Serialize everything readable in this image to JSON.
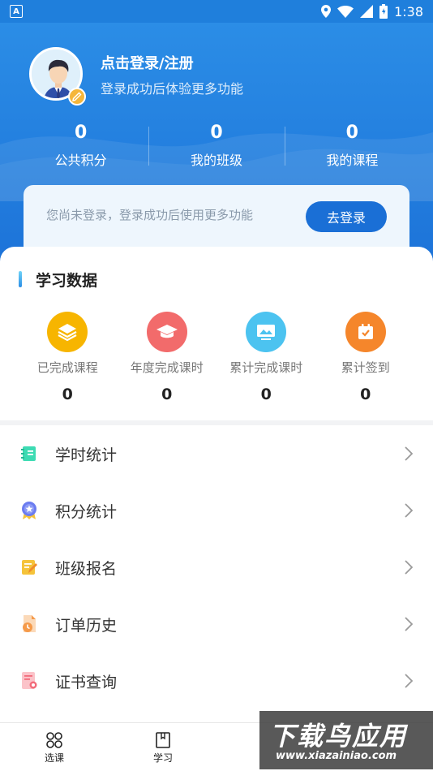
{
  "status_bar": {
    "time": "1:38"
  },
  "header": {
    "login_title": "点击登录/注册",
    "login_subtitle": "登录成功后体验更多功能",
    "stats": [
      {
        "value": "0",
        "label": "公共积分"
      },
      {
        "value": "0",
        "label": "我的班级"
      },
      {
        "value": "0",
        "label": "我的课程"
      }
    ]
  },
  "login_card": {
    "text": "您尚未登录，登录成功后使用更多功能",
    "button_label": "去登录"
  },
  "learning_data": {
    "title": "学习数据",
    "items": [
      {
        "label": "已完成课程",
        "value": "0",
        "icon": "layers-icon",
        "color": "#f7b500"
      },
      {
        "label": "年度完成课时",
        "value": "0",
        "icon": "graduation-cap-icon",
        "color": "#f26b6b"
      },
      {
        "label": "累计完成课时",
        "value": "0",
        "icon": "monitor-icon",
        "color": "#4cc3f0"
      },
      {
        "label": "累计签到",
        "value": "0",
        "icon": "calendar-check-icon",
        "color": "#f5862b"
      }
    ]
  },
  "menu": {
    "items": [
      {
        "label": "学时统计",
        "icon": "notebook-icon",
        "color": "#3ddbb3"
      },
      {
        "label": "积分统计",
        "icon": "medal-icon",
        "color": "#6b7cf0"
      },
      {
        "label": "班级报名",
        "icon": "edit-note-icon",
        "color": "#f5c33a"
      },
      {
        "label": "订单历史",
        "icon": "order-history-icon",
        "color": "#f59a4a"
      },
      {
        "label": "证书查询",
        "icon": "certificate-icon",
        "color": "#f26b7a"
      }
    ]
  },
  "bottom_nav": {
    "items": [
      {
        "label": "选课",
        "icon": "grid-icon"
      },
      {
        "label": "学习",
        "icon": "book-icon"
      }
    ]
  },
  "watermark": {
    "title": "下载鸟应用",
    "url": "www.xiazainiao.com"
  }
}
